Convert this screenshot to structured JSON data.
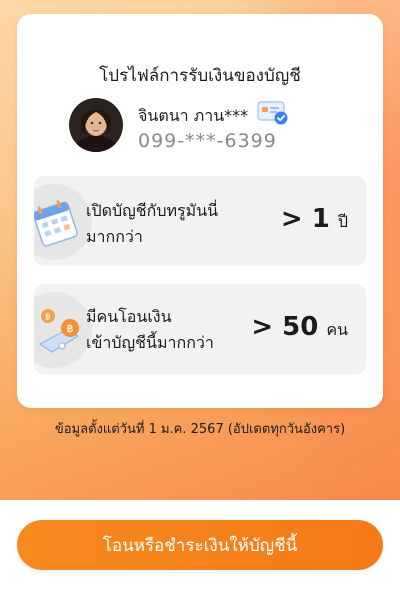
{
  "profile_card": {
    "title": "โปรไฟล์การรับเงินของบัญชี",
    "name": "จินตนา ภาน***",
    "phone": "099-***-6399"
  },
  "stats": [
    {
      "label_line1": "เปิดบัญชีกับทรูมันนี่",
      "label_line2": "มากกว่า",
      "value": "> 1",
      "unit": "ปี",
      "icon": "calendar-icon"
    },
    {
      "label_line1": "มีคนโอนเงิน",
      "label_line2": "เข้าบัญชีนี้มากกว่า",
      "value": "> 50",
      "unit": "คน",
      "icon": "coins-transfer-icon"
    }
  ],
  "data_note": "ข้อมูลตั้งแต่วันที่ 1 ม.ค. 2567 (อัปเดตทุกวันอังคาร)",
  "cta_label": "โอนหรือชำระเงินให้บัญชีนี้",
  "colors": {
    "accent": "#F58A1F",
    "background_gradient": [
      "#FCD7A6",
      "#F7894A"
    ],
    "verified_badge": "#3B82F6"
  }
}
